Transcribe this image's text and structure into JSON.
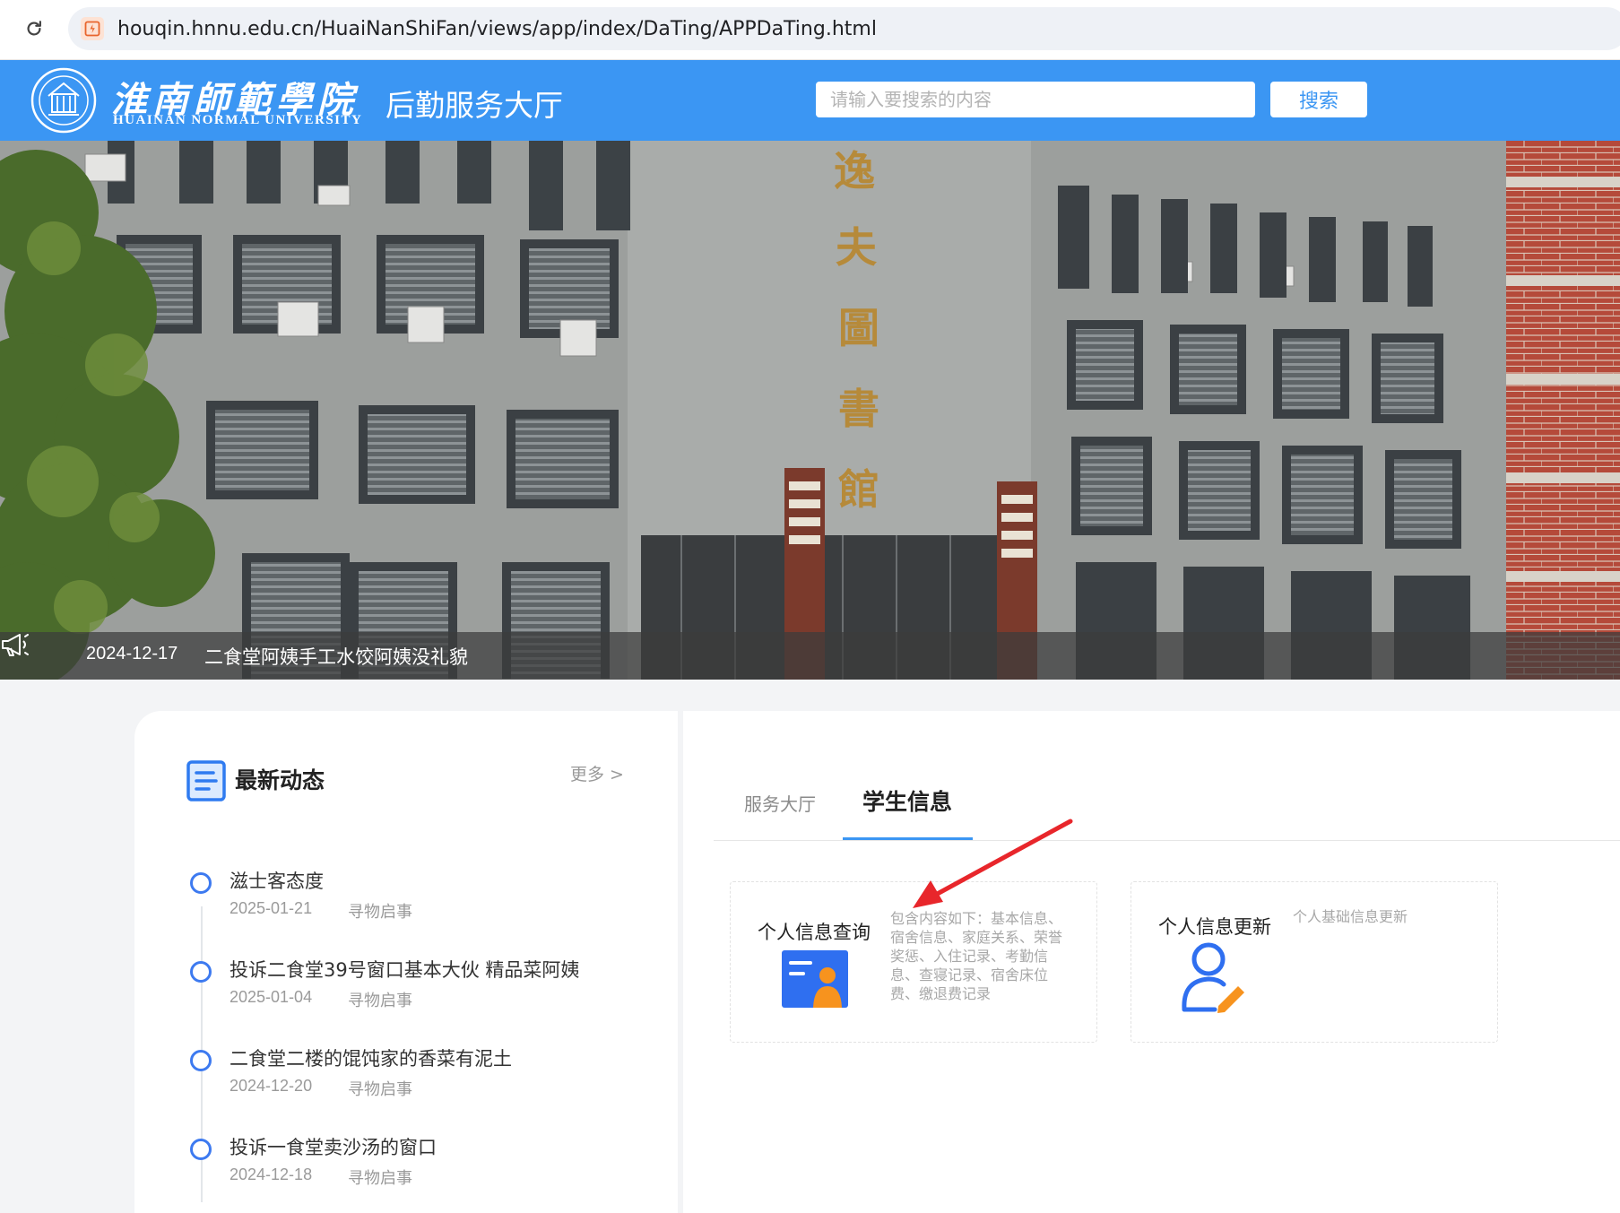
{
  "browser": {
    "url": "houqin.hnnu.edu.cn/HuaiNanShiFan/views/app/index/DaTing/APPDaTing.html"
  },
  "header": {
    "university_cn": "淮南師範學院",
    "university_en": "HUAINAN NORMAL UNIVERSITY",
    "title": "后勤服务大厅",
    "search_placeholder": "请输入要搜索的内容",
    "search_button": "搜索",
    "brand_color": "#3b96f3"
  },
  "banner": {
    "notice_date": "2024-12-17",
    "notice_text": "二食堂阿姨手工水饺阿姨没礼貌"
  },
  "news": {
    "title": "最新动态",
    "more_label": "更多 >",
    "items": [
      {
        "title": "滋士客态度",
        "date": "2025-01-21",
        "category": "寻物启事"
      },
      {
        "title": "投诉二食堂39号窗口基本大伙 精品菜阿姨",
        "date": "2025-01-04",
        "category": "寻物启事"
      },
      {
        "title": "二食堂二楼的馄饨家的香菜有泥土",
        "date": "2024-12-20",
        "category": "寻物启事"
      },
      {
        "title": "投诉一食堂卖沙汤的窗口",
        "date": "2024-12-18",
        "category": "寻物启事"
      }
    ]
  },
  "tabs": {
    "service_hall": "服务大厅",
    "student_info": "学生信息",
    "active": "学生信息"
  },
  "cards": [
    {
      "title": "个人信息查询",
      "description": "包含内容如下：基本信息、宿舍信息、家庭关系、荣誉奖惩、入住记录、考勤信息、查寝记录、宿舍床位费、缴退费记录",
      "icon": "id-card-icon"
    },
    {
      "title": "个人信息更新",
      "description": "个人基础信息更新",
      "icon": "user-edit-icon"
    }
  ]
}
